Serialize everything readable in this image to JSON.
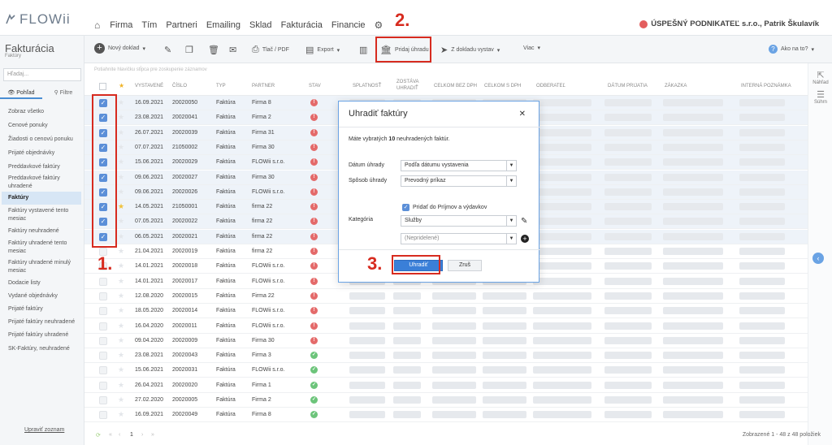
{
  "app": {
    "logo_text": "FLOWii"
  },
  "nav": {
    "items": [
      "Firma",
      "Tím",
      "Partneri",
      "Emailing",
      "Sklad",
      "Fakturácia",
      "Financie"
    ],
    "company": "ÚSPEŠNÝ PODNIKATEĽ s.r.o., Patrik Škulavík"
  },
  "annotations": {
    "one": "1.",
    "two": "2.",
    "three": "3."
  },
  "toolbar": {
    "new_doc": "Nový doklad",
    "print": "Tlač / PDF",
    "export": "Export",
    "add_payment": "Pridaj úhradu",
    "from_doc": "Z dokladu vystav",
    "more": "Viac",
    "help": "Ako na to?"
  },
  "sidebar": {
    "title": "Fakturácia",
    "subtitle": "Faktúry",
    "search_placeholder": "Hľadaj...",
    "tab_view": "Pohľad",
    "tab_filter": "Filtre",
    "items": [
      "Zobraz všetko",
      "Cenové ponuky",
      "Žiadosti o cenovú ponuku",
      "Prijaté objednávky",
      "Preddavkové faktúry",
      "Preddavkové faktúry uhradené",
      "Faktúry",
      "Faktúry vystavené tento mesiac",
      "Faktúry neuhradené",
      "Faktúry uhradené tento mesiac",
      "Faktúry uhradené minulý mesiac",
      "Dodacie listy",
      "Vydané objednávky",
      "Prijaté faktúry",
      "Prijaté faktúry neuhradené",
      "Prijaté faktúry uhradené",
      "SK-Faktúry, neuhradené"
    ],
    "manage": "Upraviť zoznam"
  },
  "table": {
    "filter_hint": "Potiahnite hlavičku stĺpca pre zoskupenie záznamov",
    "headers": [
      "Vystavené",
      "Číslo",
      "Typ",
      "Partner",
      "Stav",
      "Splatnosť",
      "Zostáva uhradiť",
      "Celkom bez DPH",
      "Celkom s DPH",
      "Odberateľ",
      "Dátum prijatia",
      "Zákazka",
      "Interná poznámka"
    ],
    "rows": [
      {
        "date": "16.09.2021",
        "num": "20020050",
        "type": "Faktúra",
        "partner": "Firma 8",
        "status": "!",
        "checked": true,
        "star": false
      },
      {
        "date": "23.08.2021",
        "num": "20020041",
        "type": "Faktúra",
        "partner": "Firma 2",
        "status": "!",
        "checked": true,
        "star": false
      },
      {
        "date": "26.07.2021",
        "num": "20020039",
        "type": "Faktúra",
        "partner": "Firma 31",
        "status": "!",
        "checked": true,
        "star": false
      },
      {
        "date": "07.07.2021",
        "num": "21050002",
        "type": "Faktúra",
        "partner": "Firma 30",
        "status": "!",
        "checked": true,
        "star": false
      },
      {
        "date": "15.06.2021",
        "num": "20020029",
        "type": "Faktúra",
        "partner": "FLOWii s.r.o.",
        "status": "!",
        "checked": true,
        "star": false
      },
      {
        "date": "09.06.2021",
        "num": "20020027",
        "type": "Faktúra",
        "partner": "Firma 30",
        "status": "!",
        "checked": true,
        "star": false
      },
      {
        "date": "09.06.2021",
        "num": "20020026",
        "type": "Faktúra",
        "partner": "FLOWii s.r.o.",
        "status": "!",
        "checked": true,
        "star": false
      },
      {
        "date": "14.05.2021",
        "num": "21050001",
        "type": "Faktúra",
        "partner": "firma 22",
        "status": "!",
        "checked": true,
        "star": true
      },
      {
        "date": "07.05.2021",
        "num": "20020022",
        "type": "Faktúra",
        "partner": "firma 22",
        "status": "!",
        "checked": true,
        "star": false
      },
      {
        "date": "06.05.2021",
        "num": "20020021",
        "type": "Faktúra",
        "partner": "firma 22",
        "status": "!",
        "checked": true,
        "star": false
      },
      {
        "date": "21.04.2021",
        "num": "20020019",
        "type": "Faktúra",
        "partner": "firma 22",
        "status": "!",
        "checked": false,
        "star": false
      },
      {
        "date": "14.01.2021",
        "num": "20020018",
        "type": "Faktúra",
        "partner": "FLOWii s.r.o.",
        "status": "!",
        "checked": false,
        "star": false
      },
      {
        "date": "14.01.2021",
        "num": "20020017",
        "type": "Faktúra",
        "partner": "FLOWii s.r.o.",
        "status": "!",
        "checked": false,
        "star": false
      },
      {
        "date": "12.08.2020",
        "num": "20020015",
        "type": "Faktúra",
        "partner": "Firma 22",
        "status": "!",
        "checked": false,
        "star": false
      },
      {
        "date": "18.05.2020",
        "num": "20020014",
        "type": "Faktúra",
        "partner": "FLOWii s.r.o.",
        "status": "!",
        "checked": false,
        "star": false
      },
      {
        "date": "16.04.2020",
        "num": "20020011",
        "type": "Faktúra",
        "partner": "FLOWii s.r.o.",
        "status": "!",
        "checked": false,
        "star": false
      },
      {
        "date": "09.04.2020",
        "num": "20020009",
        "type": "Faktúra",
        "partner": "Firma 30",
        "status": "!",
        "checked": false,
        "star": false
      },
      {
        "date": "23.08.2021",
        "num": "20020043",
        "type": "Faktúra",
        "partner": "Firma 3",
        "status": "ok",
        "checked": false,
        "star": false
      },
      {
        "date": "15.06.2021",
        "num": "20020031",
        "type": "Faktúra",
        "partner": "FLOWii s.r.o.",
        "status": "ok",
        "checked": false,
        "star": false
      },
      {
        "date": "26.04.2021",
        "num": "20020020",
        "type": "Faktúra",
        "partner": "Firma 1",
        "status": "ok",
        "checked": false,
        "star": false
      },
      {
        "date": "27.02.2020",
        "num": "20020005",
        "type": "Faktúra",
        "partner": "Firma 2",
        "status": "ok",
        "checked": false,
        "star": false
      },
      {
        "date": "16.09.2021",
        "num": "20020049",
        "type": "Faktúra",
        "partner": "Firma 8",
        "status": "ok",
        "checked": false,
        "star": false
      }
    ]
  },
  "footer": {
    "page": "1",
    "summary": "Zobrazené 1 - 48 z 48 položiek"
  },
  "right_panel": {
    "preview": "Náhľad",
    "summary": "Súhrn"
  },
  "modal": {
    "title": "Uhradiť faktúry",
    "info_prefix": "Máte vybratých ",
    "info_count": "10",
    "info_suffix": " neuhradených faktúr.",
    "date_label": "Dátum úhrady",
    "date_value": "Podľa dátumu vystavenia",
    "method_label": "Spôsob úhrady",
    "method_value": "Prevodný príkaz",
    "add_checkbox": "Pridať do Príjmov a výdavkov",
    "category_label": "Kategória",
    "category_value": "Služby",
    "sub_value": "(Nepridelené)",
    "pay_button": "Uhradiť",
    "cancel_button": "Zruš"
  },
  "colors": {
    "accent": "#3a7fd8",
    "annotation": "#d72b1f",
    "status_red": "#e46a6a",
    "status_green": "#6cc47a"
  }
}
